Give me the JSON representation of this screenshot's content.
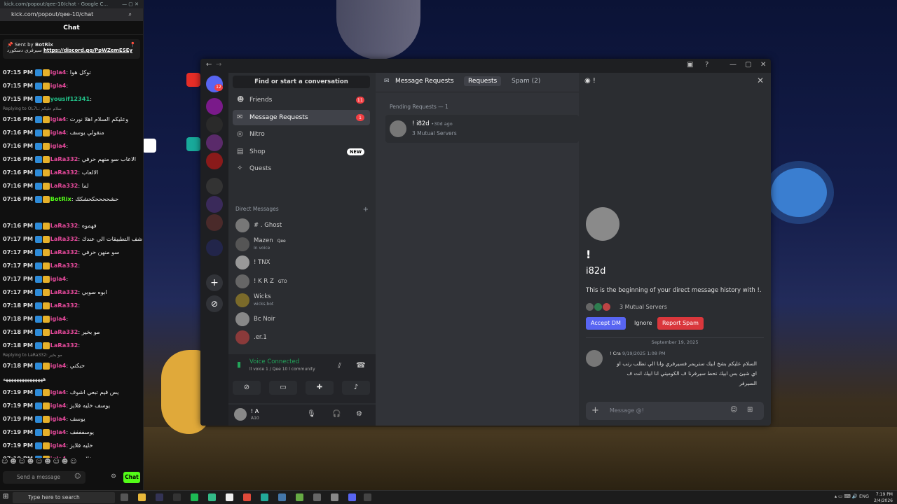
{
  "browser": {
    "url": "kick.com/popout/qee-10/chat - Google C...",
    "address": "kick.com/popout/qee-10/chat"
  },
  "chat": {
    "title": "Chat",
    "pinned_sender": "Sent by",
    "pinned_bot": "BotRix",
    "pinned_text": "سيرفري دسكورد",
    "pinned_link": "https://discord.gg/PpWZemESEy",
    "messages": [
      {
        "time": "07:15 PM",
        "user": "igla4",
        "color": "#e84a9d",
        "text": ": توكل هوا"
      },
      {
        "time": "07:15 PM",
        "user": "igla4",
        "color": "#e84a9d",
        "text": ":"
      },
      {
        "time": "07:15 PM",
        "user": "yousif12341",
        "color": "#22c58b",
        "text": ":"
      },
      {
        "reply": "Replying to OL7L: سلام عليكم"
      },
      {
        "time": "07:16 PM",
        "user": "igla4",
        "color": "#e84a9d",
        "text": ": وعليكم السلام اهلا نورت"
      },
      {
        "time": "07:16 PM",
        "user": "igla4",
        "color": "#e84a9d",
        "text": ": منقولي يوسف"
      },
      {
        "time": "07:16 PM",
        "user": "igla4",
        "color": "#e84a9d",
        "text": ":"
      },
      {
        "time": "07:16 PM",
        "user": "LaRa332",
        "color": "#e84a9d",
        "text": ": الاعاب سو منهم حرفي"
      },
      {
        "time": "07:16 PM",
        "user": "LaRa332",
        "color": "#e84a9d",
        "text": ": الالعاب"
      },
      {
        "time": "07:16 PM",
        "user": "LaRa332",
        "color": "#e84a9d",
        "text": ": لما"
      },
      {
        "time": "07:16 PM",
        "user": "BotRix",
        "color": "#53fc18",
        "text": ": حشححححكحشكك"
      },
      {
        "time": "",
        "user": "",
        "color": "#fff",
        "text": ""
      },
      {
        "time": "07:16 PM",
        "user": "LaRa332",
        "color": "#e84a9d",
        "text": ": فهموه"
      },
      {
        "time": "07:17 PM",
        "user": "LaRa332",
        "color": "#e84a9d",
        "text": ": شف التطبيقات الي عندك"
      },
      {
        "time": "07:17 PM",
        "user": "LaRa332",
        "color": "#e84a9d",
        "text": ": سو منهن حرفي"
      },
      {
        "time": "07:17 PM",
        "user": "LaRa332",
        "color": "#e84a9d",
        "text": ":"
      },
      {
        "time": "07:17 PM",
        "user": "igla4",
        "color": "#e84a9d",
        "text": ":"
      },
      {
        "time": "07:17 PM",
        "user": "LaRa332",
        "color": "#e84a9d",
        "text": ": ابوه سوبي"
      },
      {
        "time": "07:18 PM",
        "user": "LaRa332",
        "color": "#e84a9d",
        "text": ":"
      },
      {
        "time": "07:18 PM",
        "user": "igla4",
        "color": "#e84a9d",
        "text": ":"
      },
      {
        "time": "07:18 PM",
        "user": "LaRa332",
        "color": "#e84a9d",
        "text": ": مو بخير"
      },
      {
        "time": "07:18 PM",
        "user": "LaRa332",
        "color": "#e84a9d",
        "text": ":"
      },
      {
        "reply": "Replying to LaRa332: مو بخير"
      },
      {
        "time": "07:18 PM",
        "user": "igla4",
        "color": "#e84a9d",
        "text": ": حبكتي"
      },
      {
        "time": "",
        "user": "",
        "color": "#fff",
        "text": "هههههههههههههههه"
      },
      {
        "time": "07:19 PM",
        "user": "igla4",
        "color": "#e84a9d",
        "text": ": يس قيم تبعي اشوف"
      },
      {
        "time": "07:19 PM",
        "user": "igla4",
        "color": "#e84a9d",
        "text": ": يوسف خليه فلايز"
      },
      {
        "time": "07:19 PM",
        "user": "igla4",
        "color": "#e84a9d",
        "text": ": يوسف"
      },
      {
        "time": "07:19 PM",
        "user": "igla4",
        "color": "#e84a9d",
        "text": ": يوسفففف"
      },
      {
        "time": "07:19 PM",
        "user": "igla4",
        "color": "#e84a9d",
        "text": ": خليه فلايز"
      },
      {
        "time": "07:19 PM",
        "user": "igla4",
        "color": "#e84a9d",
        "text": ": فلايززززز"
      }
    ],
    "input_placeholder": "Send a message",
    "send_label": "Chat"
  },
  "discord": {
    "search_label": "Find or start a conversation",
    "nav": [
      {
        "label": "Friends",
        "icon": "friends-icon",
        "badge": "11"
      },
      {
        "label": "Message Requests",
        "icon": "mail-icon",
        "badge": "1"
      },
      {
        "label": "Nitro",
        "icon": "nitro-icon",
        "badge": ""
      },
      {
        "label": "Shop",
        "icon": "shop-icon",
        "badge": "NEW"
      },
      {
        "label": "Quests",
        "icon": "quests-icon",
        "badge": ""
      }
    ],
    "dm_header": "Direct Messages",
    "dms": [
      {
        "name": "# . Ghost",
        "sub": ""
      },
      {
        "name": "Mazen",
        "sub": "In voice",
        "tag": "Qee"
      },
      {
        "name": "! TNX",
        "sub": ""
      },
      {
        "name": "! K R Z",
        "sub": "",
        "tag": "GTO"
      },
      {
        "name": "Wicks",
        "sub": "wicks.bot"
      },
      {
        "name": "Bc Noir",
        "sub": ""
      },
      {
        "name": ".er.1",
        "sub": ""
      }
    ],
    "voice": {
      "title": "Voice Connected",
      "sub": "ll voice 1 / Qee 10 l community"
    },
    "user": {
      "name": "! A",
      "status": "A10"
    },
    "tabs": {
      "header": "Message Requests",
      "requests": "Requests",
      "spam": "Spam (2)"
    },
    "pending": "Pending Requests — 1",
    "request": {
      "name": "! i82d",
      "time": "•30d ago",
      "mutual": "3 Mutual Servers"
    },
    "side": {
      "header": "!",
      "excl": "!",
      "username": "i82d",
      "beginning": "This is the beginning of your direct message history with !.",
      "mutual": "3 Mutual Servers",
      "accept": "Accept DM",
      "ignore": "Ignore",
      "report": "Report Spam",
      "date": "September 19, 2025",
      "msg_name": "! Cra",
      "msg_time": "9/19/2025 1:08 PM",
      "msg_text": "السلام عليكم بشخ ابيك ستريمر فسيرفري وانا الي تطلب رتب او اي شيئ بس ابيك تحط سيرفرنا ف الكوميتي انا ابيك انت ف السيرفر",
      "compose_placeholder": "Message @!"
    }
  },
  "taskbar": {
    "search_placeholder": "Type here to search",
    "lang": "ENG",
    "time": "7:19 PM",
    "date": "2/4/2026"
  },
  "colors": {
    "discord_blurple": "#5865f2",
    "kick_green": "#53fc18",
    "danger": "#da373c"
  }
}
